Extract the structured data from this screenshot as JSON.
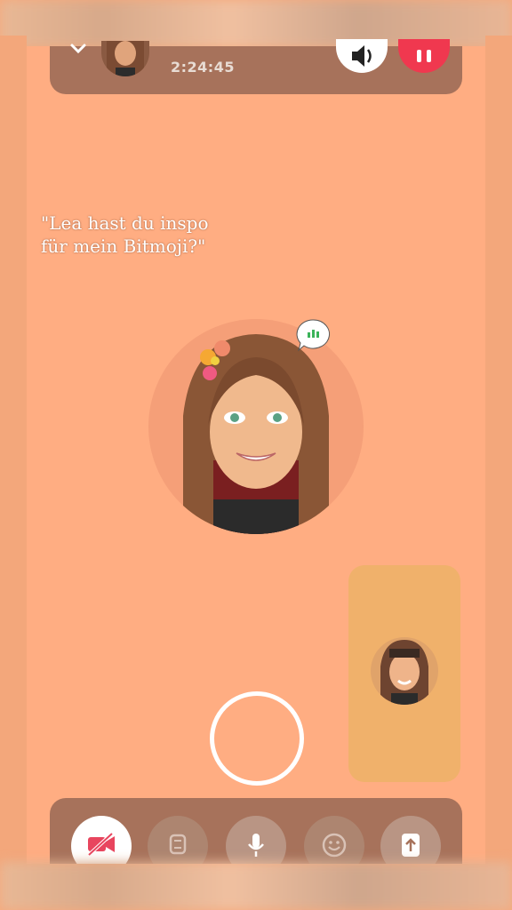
{
  "call": {
    "timer": "2:24:45"
  },
  "overlay": {
    "quote": "\"Lea hast du inspo\nfür mein Bitmoji?\""
  },
  "icons": {
    "speaker": "speaker-icon",
    "end_call": "end-call-icon",
    "chat": "chat-bubble-icon",
    "video_off": "video-off-icon",
    "flip_camera": "flip-camera-icon",
    "microphone": "microphone-icon",
    "emoji": "emoji-icon",
    "share": "share-icon"
  },
  "colors": {
    "background": "#ffad82",
    "bar": "#a7725b",
    "end_call": "#f0384f",
    "self_view": "#f0b16b",
    "video_off_icon": "#e8455e"
  }
}
